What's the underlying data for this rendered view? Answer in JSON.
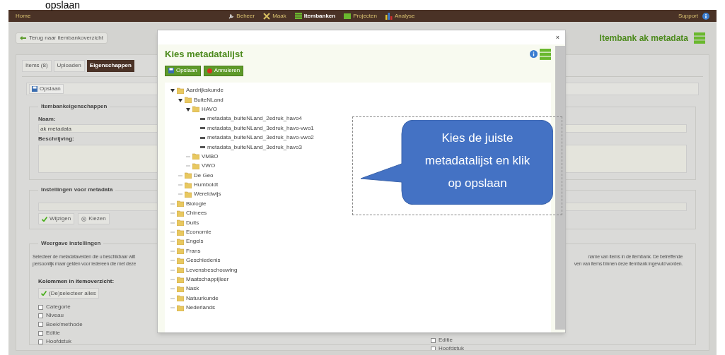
{
  "top_caption": "opslaan",
  "nav": {
    "home": "Home",
    "items": [
      {
        "label": "Beheer",
        "selected": false
      },
      {
        "label": "Maak",
        "selected": false
      },
      {
        "label": "Itembanken",
        "selected": true
      },
      {
        "label": "Projecten",
        "selected": false
      },
      {
        "label": "Analyse",
        "selected": false
      }
    ],
    "support": "Support"
  },
  "back_button": "Terug naar itembankoverzicht",
  "page_title": "Itembank ak metadata",
  "tabs": [
    {
      "label": "Items (8)",
      "selected": false
    },
    {
      "label": "Uploaden",
      "selected": false
    },
    {
      "label": "Eigenschappen",
      "selected": true
    }
  ],
  "save_button": "Opslaan",
  "properties": {
    "legend": "Itembankeigenschappen",
    "name_label": "Naam:",
    "name_value": "ak metadata",
    "description_label": "Beschrijving:"
  },
  "metadata_settings": {
    "legend": "Instellingen voor metadata",
    "buttons": [
      {
        "label": "Wijzigen",
        "kind": "check"
      },
      {
        "label": "Kiezen",
        "kind": "radio"
      }
    ]
  },
  "display_settings": {
    "legend": "Weergave instellingen",
    "text_left": [
      "Selecteer de metadatavelden die u beschikbaar wilt",
      "persoonlijk maar gelden voor iedereen die met deze"
    ],
    "text_right": [
      "name van items in de itembank. De betreffende",
      "ven van items binnen deze itembank ingevuld worden."
    ],
    "columns_label": "Kolommen in itemoverzicht:",
    "select_all": "(De)selecteer alles",
    "columns_left": [
      {
        "label": "Categorie",
        "checked": false
      },
      {
        "label": "Niveau",
        "checked": false
      },
      {
        "label": "Boek/methode",
        "checked": false
      },
      {
        "label": "Editie",
        "checked": false
      },
      {
        "label": "Hoofdstuk",
        "checked": false
      }
    ],
    "columns_right": [
      {
        "label": "Editie",
        "checked": false
      },
      {
        "label": "Hoofdstuk",
        "checked": false
      }
    ]
  },
  "dialog": {
    "close": "×",
    "title": "Kies metadatalijst",
    "buttons": [
      {
        "label": "Opslaan",
        "kind": "save"
      },
      {
        "label": "Annuleren",
        "kind": "cancel"
      }
    ],
    "tree": [
      {
        "label": "Aardrijkskunde",
        "kind": "folder",
        "expanded": true,
        "children": [
          {
            "label": "BuiteNLand",
            "kind": "folder",
            "expanded": true,
            "children": [
              {
                "label": "HAVO",
                "kind": "folder",
                "expanded": true,
                "children": [
                  {
                    "label": "metadata_buiteNLand_2edruk_havo4",
                    "kind": "file"
                  },
                  {
                    "label": "metadata_buiteNLand_3edruk_havo-vwo1",
                    "kind": "file"
                  },
                  {
                    "label": "metadata_buiteNLand_3edruk_havo-vwo2",
                    "kind": "file"
                  },
                  {
                    "label": "metadata_buiteNLand_3edruk_havo3",
                    "kind": "file"
                  }
                ]
              },
              {
                "label": "VMBO",
                "kind": "folder",
                "expanded": false
              },
              {
                "label": "VWO",
                "kind": "folder",
                "expanded": false
              }
            ]
          },
          {
            "label": "De Geo",
            "kind": "folder",
            "expanded": false
          },
          {
            "label": "Humboldt",
            "kind": "folder",
            "expanded": false
          },
          {
            "label": "Wereldwijs",
            "kind": "folder",
            "expanded": false
          }
        ]
      },
      {
        "label": "Biologie",
        "kind": "folder",
        "expanded": false
      },
      {
        "label": "Chinees",
        "kind": "folder",
        "expanded": false
      },
      {
        "label": "Duits",
        "kind": "folder",
        "expanded": false
      },
      {
        "label": "Economie",
        "kind": "folder",
        "expanded": false
      },
      {
        "label": "Engels",
        "kind": "folder",
        "expanded": false
      },
      {
        "label": "Frans",
        "kind": "folder",
        "expanded": false
      },
      {
        "label": "Geschiedenis",
        "kind": "folder",
        "expanded": false
      },
      {
        "label": "Levensbeschouwing",
        "kind": "folder",
        "expanded": false
      },
      {
        "label": "Maatschappijleer",
        "kind": "folder",
        "expanded": false
      },
      {
        "label": "Nask",
        "kind": "folder",
        "expanded": false
      },
      {
        "label": "Natuurkunde",
        "kind": "folder",
        "expanded": false
      },
      {
        "label": "Nederlands",
        "kind": "folder",
        "expanded": false
      }
    ]
  },
  "callout": "Kies de juiste metadatalijst en klik op opslaan"
}
